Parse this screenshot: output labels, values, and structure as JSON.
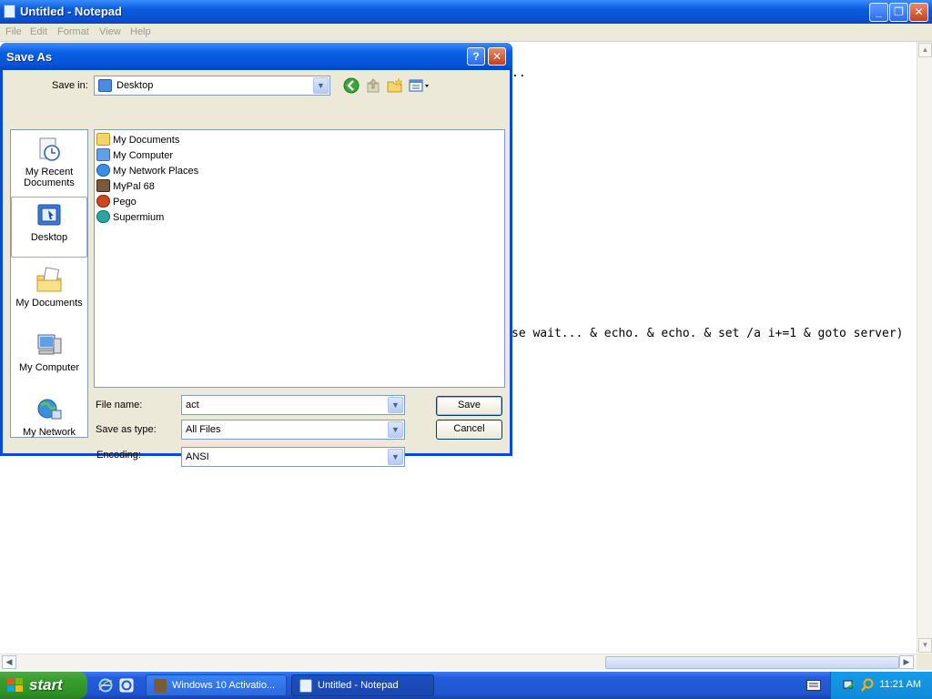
{
  "notepad": {
    "title": "Untitled - Notepad",
    "menu": [
      "File",
      "Edit",
      "Format",
      "View",
      "Help"
    ],
    "visible_text": {
      "line1_fragment": "..",
      "line2_fragment": "se wait... & echo. & echo. & set /a i+=1 & goto server)"
    }
  },
  "dialog": {
    "title": "Save As",
    "save_in_label": "Save in:",
    "save_in_value": "Desktop",
    "places": [
      "My Recent Documents",
      "Desktop",
      "My Documents",
      "My Computer",
      "My Network"
    ],
    "selected_place": "Desktop",
    "files": [
      "My Documents",
      "My Computer",
      "My Network Places",
      "MyPal 68",
      "Pego",
      "Supermium"
    ],
    "file_name_label": "File name:",
    "file_name_value": "act",
    "save_as_type_label": "Save as type:",
    "save_as_type_value": "All Files",
    "encoding_label": "Encoding:",
    "encoding_value": "ANSI",
    "save_button": "Save",
    "cancel_button": "Cancel",
    "help_button": "?",
    "close_button": "X"
  },
  "taskbar": {
    "start_label": "start",
    "tasks": [
      "Windows 10 Activatio...",
      "Untitled - Notepad"
    ],
    "active_task": "Untitled - Notepad",
    "clock": "11:21 AM"
  }
}
